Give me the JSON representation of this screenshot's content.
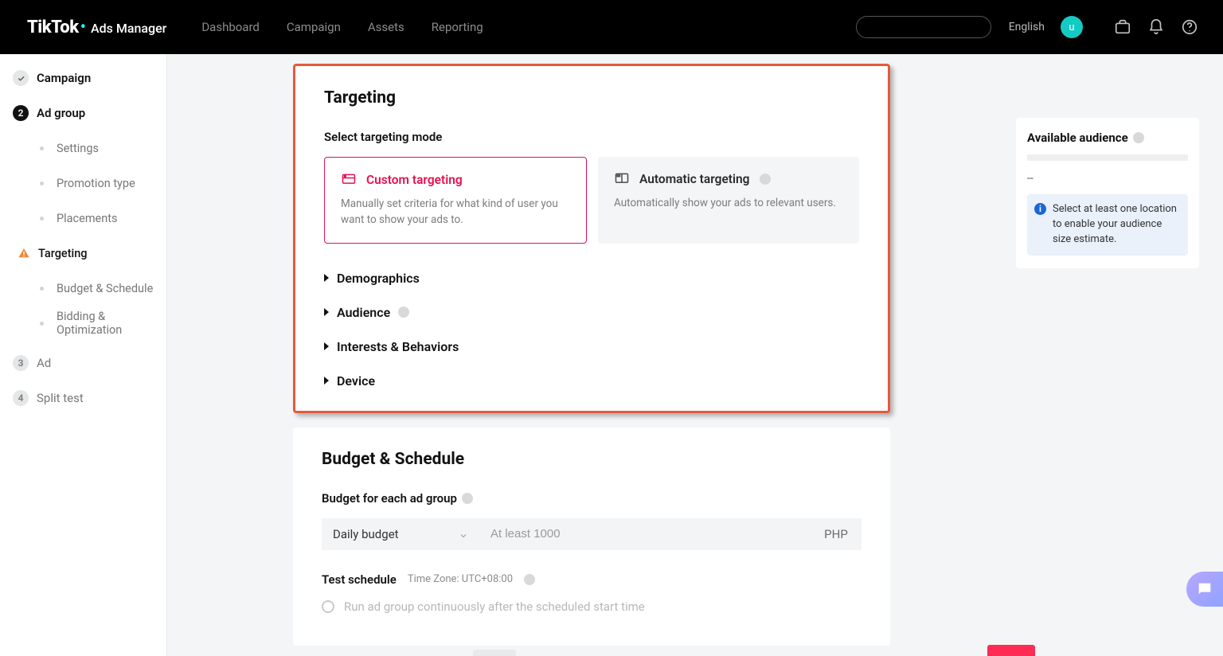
{
  "header": {
    "brand_a": "TikTok",
    "brand_b": "Ads Manager",
    "nav": {
      "dashboard": "Dashboard",
      "campaign": "Campaign",
      "assets": "Assets",
      "reporting": "Reporting"
    },
    "lang": "English",
    "avatar": "u"
  },
  "sidebar": {
    "campaign": "Campaign",
    "adgroup": "Ad group",
    "adgroup_num": "2",
    "items": {
      "settings": "Settings",
      "promotion": "Promotion type",
      "placements": "Placements",
      "targeting": "Targeting",
      "budget": "Budget & Schedule",
      "bidding": "Bidding & Optimization"
    },
    "ad": "Ad",
    "ad_num": "3",
    "split": "Split test",
    "split_num": "4"
  },
  "targeting": {
    "title": "Targeting",
    "mode_label": "Select targeting mode",
    "custom": {
      "title": "Custom targeting",
      "desc": "Manually set criteria for what kind of user you want to show your ads to."
    },
    "auto": {
      "title": "Automatic targeting",
      "desc": "Automatically show your ads to relevant users."
    },
    "acc": {
      "demo": "Demographics",
      "aud": "Audience",
      "int": "Interests & Behaviors",
      "dev": "Device"
    }
  },
  "budget": {
    "title": "Budget & Schedule",
    "label": "Budget for each ad group",
    "select": "Daily budget",
    "placeholder": "At least 1000",
    "currency": "PHP",
    "sched_label": "Test schedule",
    "tz": "Time Zone: UTC+08:00",
    "radio": "Run ad group continuously after the scheduled start time"
  },
  "right": {
    "title": "Available audience",
    "dash": "--",
    "alert": "Select at least one location to enable your audience size estimate."
  }
}
